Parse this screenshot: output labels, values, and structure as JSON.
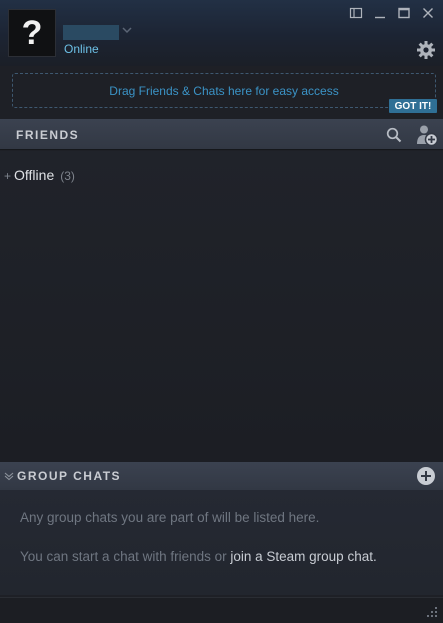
{
  "header": {
    "avatar_glyph": "?",
    "status": "Online"
  },
  "window_controls": {
    "icons": [
      "dock-icon",
      "minimize-icon",
      "maximize-icon",
      "close-icon"
    ]
  },
  "dropzone": {
    "text": "Drag Friends & Chats here for easy access",
    "got_it": "GOT IT!"
  },
  "friends": {
    "title": "FRIENDS",
    "groups": [
      {
        "toggle": "+",
        "label": "Offline",
        "count": "(3)"
      }
    ]
  },
  "group_chats": {
    "title": "GROUP CHATS",
    "message1": "Any group chats you are part of will be listed here.",
    "message2_prefix": "You can start a chat with friends or ",
    "message2_link": "join a Steam group chat."
  },
  "colors": {
    "accent": "#6dc0e6",
    "link_blue": "#3b93c6",
    "got_it_bg": "#2f6f95",
    "background": "#1e2026"
  }
}
